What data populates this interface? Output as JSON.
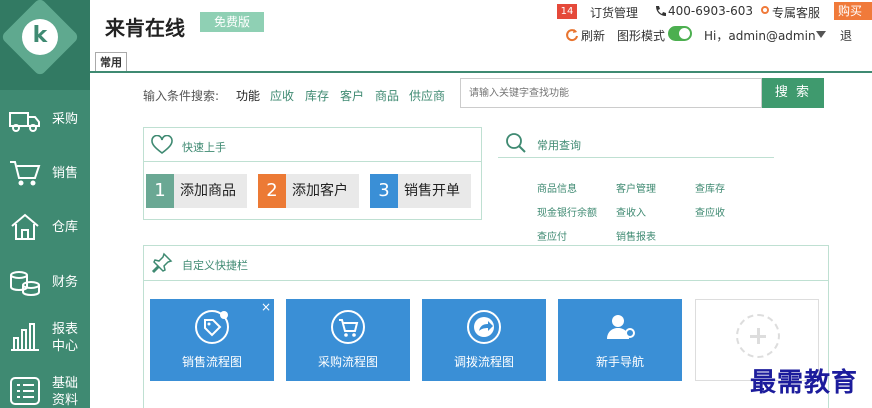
{
  "header": {
    "title": "来肯在线",
    "edition_badge": "免费版",
    "order_count": "14",
    "order_manage": "订货管理",
    "phone": "400-6903-603",
    "customer_service": "专属客服",
    "vip_label": "购买",
    "refresh": "刷新",
    "graph_mode": "图形模式",
    "greeting": "Hi，admin@admin",
    "logout": "退"
  },
  "logo_letter": "k",
  "sidebar": {
    "items": [
      {
        "label": "采购",
        "icon": "truck-icon"
      },
      {
        "label": "销售",
        "icon": "cart-icon"
      },
      {
        "label": "仓库",
        "icon": "home-icon"
      },
      {
        "label": "财务",
        "icon": "coins-icon"
      },
      {
        "label": "报表\n中心",
        "icon": "bar-chart-icon"
      },
      {
        "label": "基础\n资料",
        "icon": "list-icon"
      }
    ]
  },
  "tabs": [
    {
      "label": "常用"
    }
  ],
  "search": {
    "label": "输入条件搜索:",
    "categories": [
      "功能",
      "应收",
      "库存",
      "客户",
      "商品",
      "供应商"
    ],
    "placeholder": "请输入关键字查找功能",
    "button": "搜 索"
  },
  "quick_start": {
    "title": "快速上手",
    "items": [
      {
        "num": "1",
        "label": "添加商品",
        "color": "#6aa894"
      },
      {
        "num": "2",
        "label": "添加客户",
        "color": "#ec7a35"
      },
      {
        "num": "3",
        "label": "销售开单",
        "color": "#3a8fd6"
      }
    ]
  },
  "common_query": {
    "title": "常用查询",
    "links": [
      "商品信息",
      "客户管理",
      "查库存",
      "现金银行余额",
      "查收入",
      "查应收",
      "查应付",
      "销售报表"
    ]
  },
  "custom_shortcuts": {
    "title": "自定义快捷栏",
    "tiles": [
      {
        "label": "销售流程图",
        "icon": "tag-icon"
      },
      {
        "label": "采购流程图",
        "icon": "cart-icon"
      },
      {
        "label": "调拨流程图",
        "icon": "share-icon"
      },
      {
        "label": "新手导航",
        "icon": "user-pin-icon"
      }
    ],
    "close_symbol": "×"
  },
  "colors": {
    "sidebar": "#3f8a72",
    "accent_green": "#3f9a6e",
    "tile_blue": "#3a8fd6",
    "badge_red": "#e5493a",
    "orange": "#ec7a35"
  },
  "watermark": "最需教育"
}
